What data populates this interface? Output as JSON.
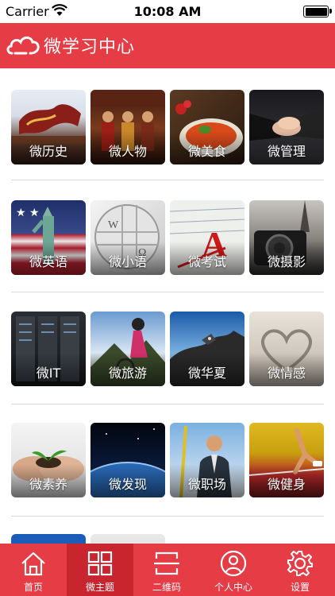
{
  "status_bar": {
    "carrier": "Carrier",
    "time": "10:08 AM"
  },
  "nav": {
    "title": "微学习中心"
  },
  "tiles": [
    {
      "label": "微历史"
    },
    {
      "label": "微人物"
    },
    {
      "label": "微美食"
    },
    {
      "label": "微管理"
    },
    {
      "label": "微英语"
    },
    {
      "label": "微小语"
    },
    {
      "label": "微考试"
    },
    {
      "label": "微摄影"
    },
    {
      "label": "微IT"
    },
    {
      "label": "微旅游"
    },
    {
      "label": "微华夏"
    },
    {
      "label": "微情感"
    },
    {
      "label": "微素养"
    },
    {
      "label": "微发现"
    },
    {
      "label": "微职场"
    },
    {
      "label": "微健身"
    }
  ],
  "tab_bar": {
    "active": "微主题",
    "items": [
      {
        "label": "首页",
        "icon": "home-icon"
      },
      {
        "label": "微主题",
        "icon": "grid-icon"
      },
      {
        "label": "二维码",
        "icon": "qr-scan-icon"
      },
      {
        "label": "个人中心",
        "icon": "user-icon"
      },
      {
        "label": "设置",
        "icon": "gear-icon"
      }
    ]
  },
  "colors": {
    "brand_red": "#e53c46",
    "tab_active": "#c8252f"
  }
}
